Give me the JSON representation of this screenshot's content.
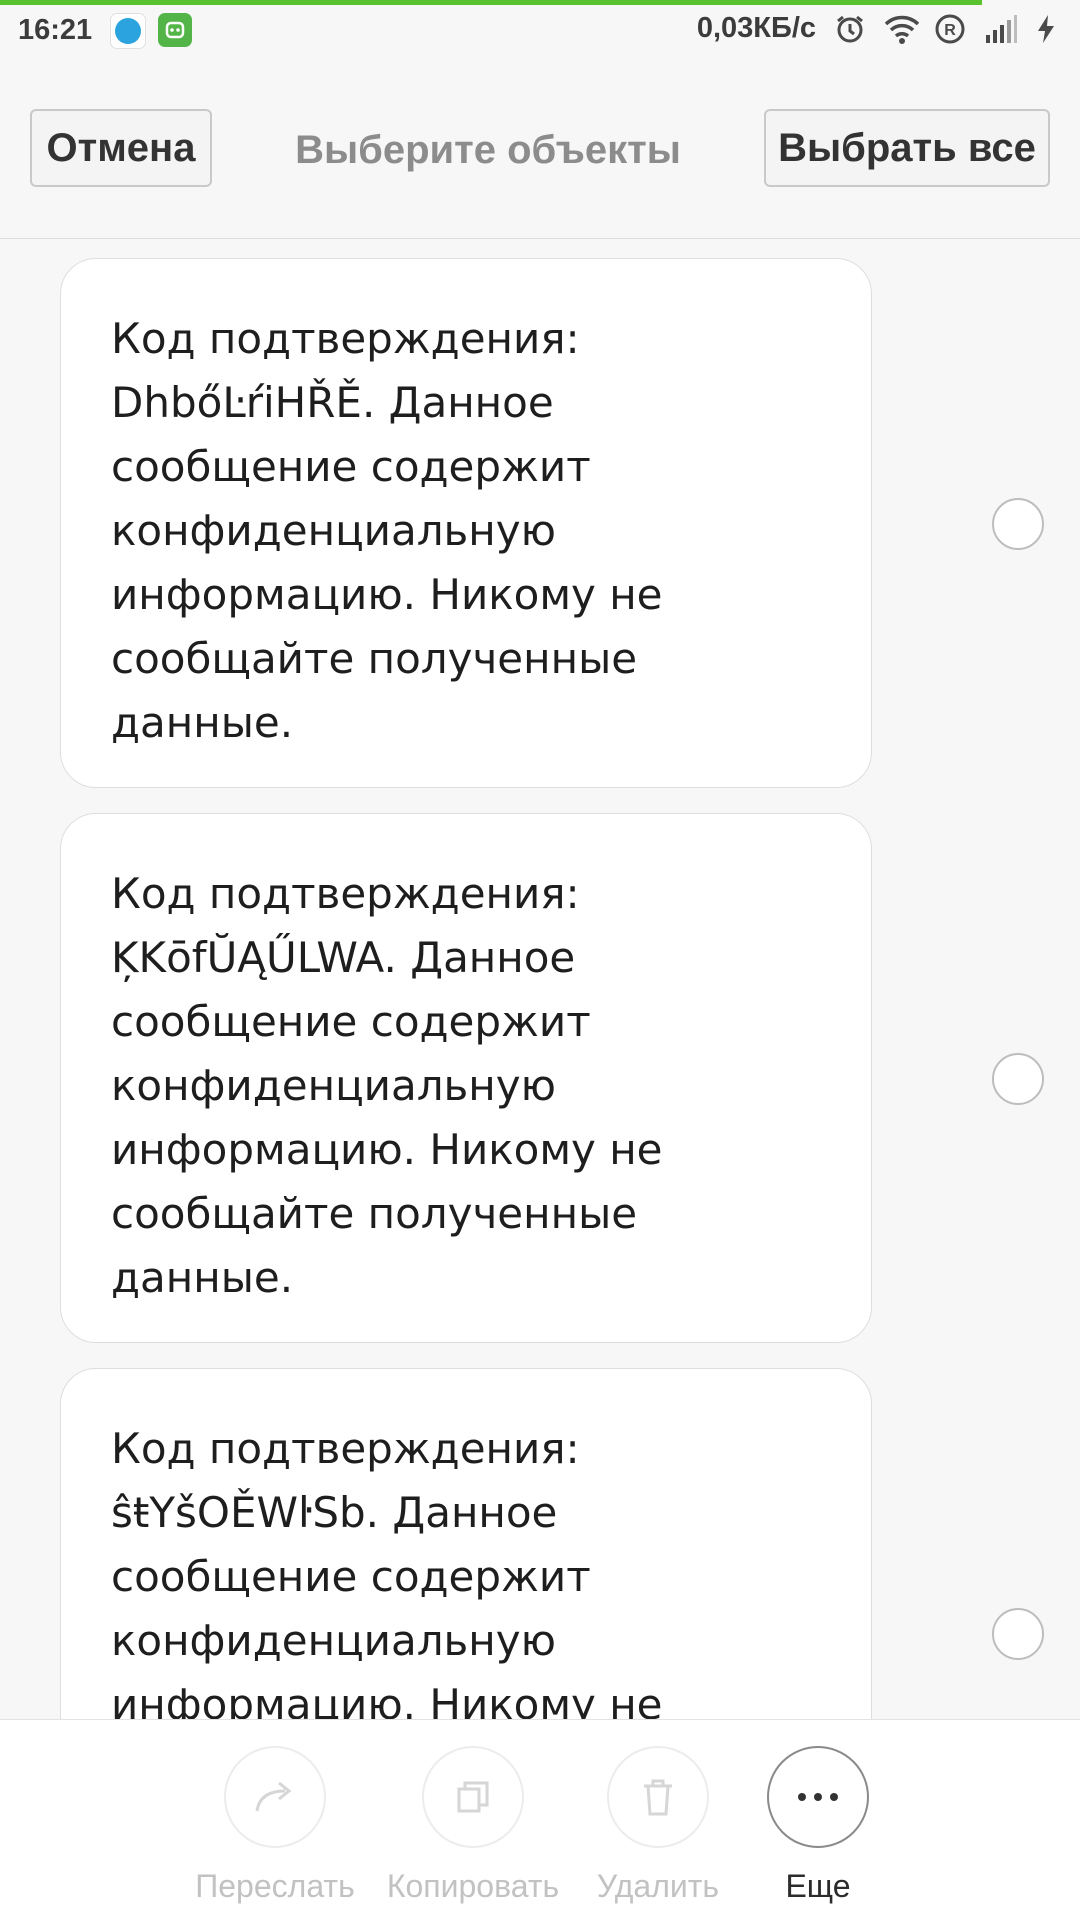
{
  "status_bar": {
    "time": "16:21",
    "speed": "0,03КБ/с",
    "icons": [
      "telegram-icon",
      "bot-app-icon",
      "alarm-icon",
      "wifi-icon",
      "registered-icon",
      "signal-icon",
      "charging-icon"
    ]
  },
  "header": {
    "cancel_label": "Отмена",
    "title": "Выберите объекты",
    "select_all_label": "Выбрать все"
  },
  "messages": [
    {
      "text": "Код подтверждения:\nDhbőĿŕiHŘĚ. Данное\nсообщение содержит\nконфиденциальную\nинформацию. Никому не\nсообщайте полученные\nданные.",
      "selected": false
    },
    {
      "text": "Код подтверждения:\nĶKōfŬĄŰLWA. Данное\nсообщение содержит\nконфиденциальную\nинформацию. Никому не\nсообщайте полученные\nданные.",
      "selected": false
    },
    {
      "text": "Код подтверждения:\nŝŧYšOĚWŀSb. Данное\nсообщение содержит\nконфиденциальную\nинформацию. Никому не\nсообщайте полученные\nданные.",
      "selected": false
    }
  ],
  "toolbar": {
    "forward_label": "Переслать",
    "copy_label": "Копировать",
    "delete_label": "Удалить",
    "more_label": "Еще"
  },
  "colors": {
    "accent_progress": "#5ac22e",
    "background": "#f7f7f7",
    "bubble": "#ffffff"
  }
}
